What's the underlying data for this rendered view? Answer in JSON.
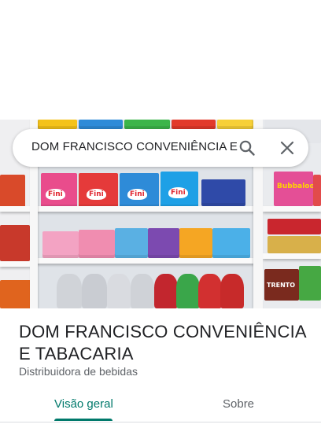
{
  "search": {
    "query": "DOM FRANCISCO CONVENIÊNCIA E",
    "search_icon": "search-icon",
    "clear_icon": "close-icon"
  },
  "place": {
    "name": "DOM FRANCISCO CONVENIÊNCIA E TABACARIA",
    "category": "Distribuidora de bebidas"
  },
  "photo": {
    "brand_labels": [
      "Fini",
      "Fini",
      "Fini",
      "Fini"
    ],
    "side_label": "Bubbaloo",
    "bottom_label": "TRENTO"
  },
  "tabs": [
    {
      "label": "Visão geral",
      "selected": true
    },
    {
      "label": "Sobre",
      "selected": false
    }
  ],
  "colors": {
    "accent": "#00796b",
    "text_primary": "#202124",
    "text_secondary": "#5f6368"
  }
}
